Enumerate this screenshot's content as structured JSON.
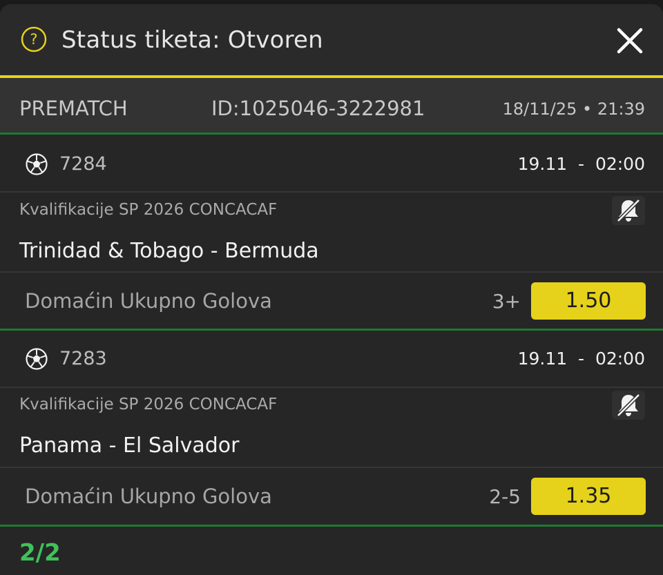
{
  "header": {
    "title": "Status tiketa: Otvoren",
    "help_icon": "question-circle-icon",
    "close_icon": "close-icon"
  },
  "ticket_info": {
    "type": "PREMATCH",
    "id": "ID:1025046-3222981",
    "datetime": "18/11/25 • 21:39"
  },
  "events": [
    {
      "sport_icon": "soccer-ball-icon",
      "event_id": "7284",
      "time": "19.11  -  02:00",
      "league": "Kvalifikacije SP 2026 CONCACAF",
      "match": "Trinidad & Tobago - Bermuda",
      "market": "Domaćin Ukupno Golova",
      "selection": "3+",
      "odds": "1.50",
      "notification_icon": "bell-off-icon"
    },
    {
      "sport_icon": "soccer-ball-icon",
      "event_id": "7283",
      "time": "19.11  -  02:00",
      "league": "Kvalifikacije SP 2026 CONCACAF",
      "match": "Panama - El Salvador",
      "market": "Domaćin Ukupno Golova",
      "selection": "2-5",
      "odds": "1.35",
      "notification_icon": "bell-off-icon"
    }
  ],
  "footer": {
    "count": "2/2"
  },
  "colors": {
    "accent_yellow": "#e6d21a",
    "accent_green": "#1e7a31",
    "count_green": "#3fc25a",
    "background": "#262626"
  }
}
